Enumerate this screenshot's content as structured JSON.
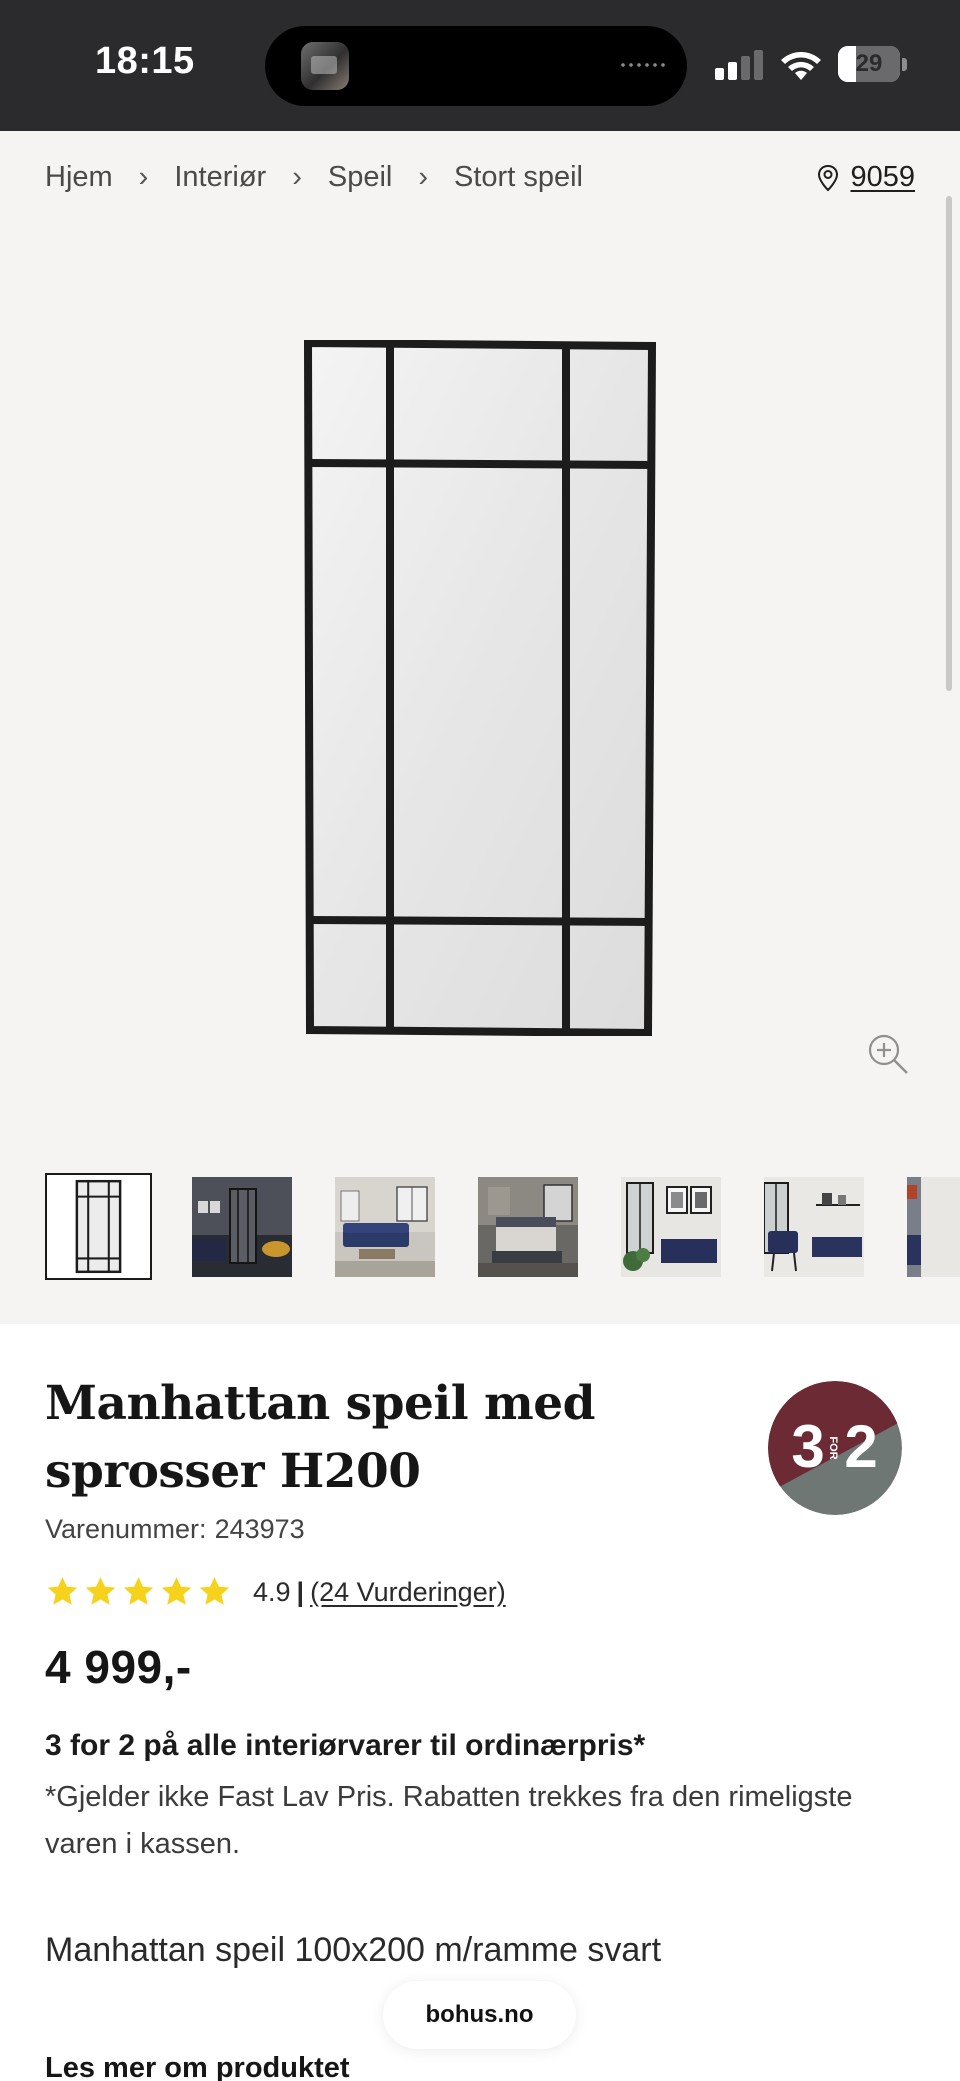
{
  "status_bar": {
    "time": "18:15",
    "battery_level": "29",
    "battery_fraction": 0.29
  },
  "breadcrumb": {
    "items": [
      "Hjem",
      "Interiør",
      "Speil",
      "Stort speil"
    ],
    "separator": "›"
  },
  "location": {
    "icon": "map-pin-icon",
    "postal_code": "9059"
  },
  "gallery": {
    "zoom_icon": "zoom-in-icon",
    "thumbnails": [
      {
        "label": "mirror-product"
      },
      {
        "label": "mirror-in-living-room"
      },
      {
        "label": "sofa-living-room"
      },
      {
        "label": "bedroom-scene"
      },
      {
        "label": "mirror-with-art"
      },
      {
        "label": "chair-and-bench"
      },
      {
        "label": "partial-thumbnail"
      }
    ]
  },
  "product": {
    "title": "Manhattan speil med sprosser H200",
    "sku_label": "Varenummer:",
    "sku": "243973",
    "rating_value": "4.9",
    "rating_stars": 5,
    "rating_separator": "|",
    "rating_count_text": "(24 Vurderinger)",
    "price": "4 999,-",
    "badge": {
      "left": "3",
      "mid": "FOR",
      "right": "2",
      "top_color": "#6b2a34",
      "bottom_color": "#6f7775"
    },
    "promo_title": "3 for 2 på alle interiørvarer til ordinærpris*",
    "promo_text": "*Gjelder ikke Fast Lav Pris. Rabatten trekkes fra den rimeligste varen i kassen.",
    "short_description": "Manhattan speil 100x200 m/ramme svart",
    "read_more": "Les mer om produktet"
  },
  "browser": {
    "url": "bohus.no"
  },
  "colors": {
    "status_bg": "#2b2b2d",
    "gallery_bg": "#f5f4f2",
    "star": "#f7d21c",
    "frame": "#1c1c1c"
  }
}
